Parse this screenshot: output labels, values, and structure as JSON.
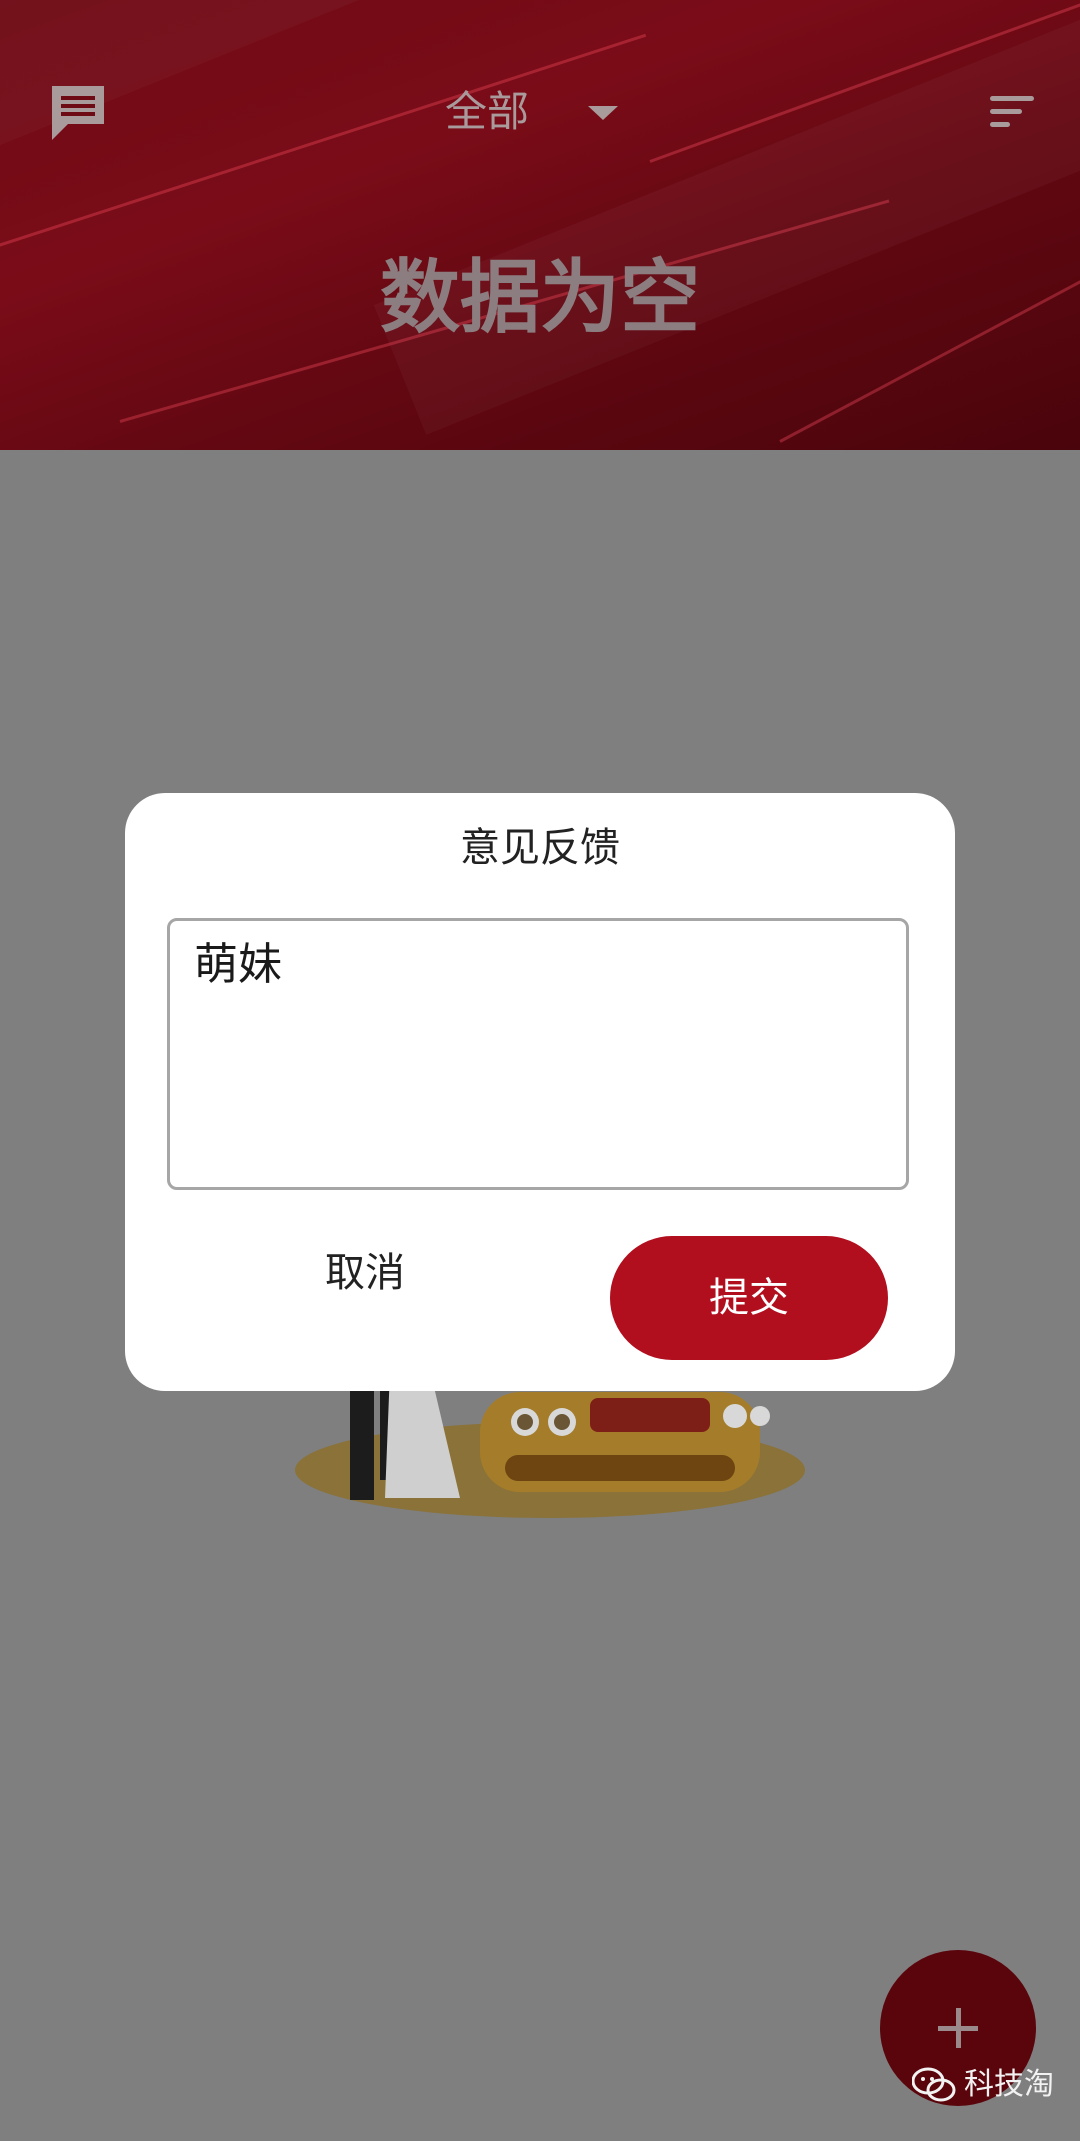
{
  "header": {
    "filter_label": "全部",
    "empty_title": "数据为空",
    "icons": {
      "message": "chat-message-icon",
      "dropdown": "caret-down-icon",
      "sort": "sort-icon"
    }
  },
  "dialog": {
    "title": "意见反馈",
    "input_value": "萌妹",
    "cancel_label": "取消",
    "submit_label": "提交"
  },
  "fab": {
    "icon": "plus-icon"
  },
  "watermark": {
    "text": "科技淘",
    "icon": "wechat-icon"
  },
  "colors": {
    "header_bg": "#6e0a14",
    "overlay": "#7f7f7f",
    "accent": "#b10e1e",
    "fab": "#5a040c"
  }
}
